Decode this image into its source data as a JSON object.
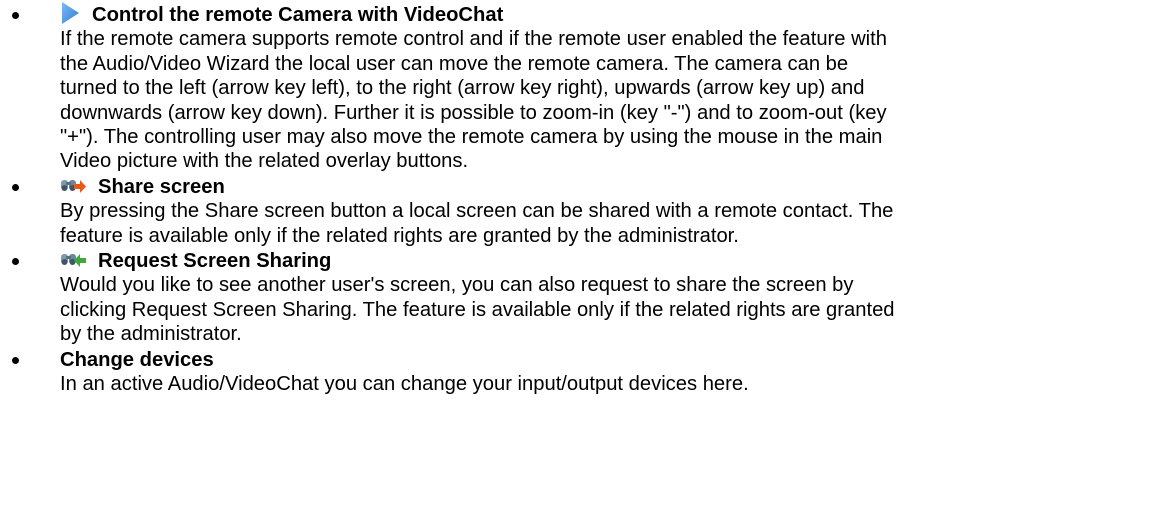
{
  "features": [
    {
      "title": "Control the remote Camera with VideoChat",
      "icon": "play-triangle-icon",
      "lines": [
        "If the remote camera supports remote control and if the remote user enabled the feature with",
        "the Audio/Video Wizard the local user can move the remote camera. The camera can be",
        "turned to the left (arrow key left), to the right (arrow key right), upwards (arrow key up) and",
        "downwards (arrow key down). Further it is possible to zoom-in (key \"-\") and to zoom-out (key",
        "\"+\"). The controlling user may also move the remote camera by using the mouse in the main",
        "Video picture with the related overlay buttons."
      ]
    },
    {
      "title": "Share screen",
      "icon": "share-screen-icon",
      "lines": [
        "By pressing the Share screen button a local screen can be shared with a remote contact. The",
        "feature is available only if the related rights are granted by the administrator."
      ]
    },
    {
      "title": "Request Screen Sharing",
      "icon": "request-screen-sharing-icon",
      "lines": [
        "Would you like to see another user's screen, you can also request to share the screen by",
        "clicking Request Screen Sharing. The feature is available only if the related rights are granted",
        "by the administrator."
      ]
    },
    {
      "title": "Change devices",
      "icon": "",
      "lines": [
        "In an active Audio/VideoChat you can change your input/output devices here."
      ]
    }
  ],
  "colors": {
    "play_icon": "#3d8fe0",
    "binocular_icon": "#6e8fa6",
    "share_arrow": "#e85a1c",
    "request_arrow": "#3fa83a"
  }
}
